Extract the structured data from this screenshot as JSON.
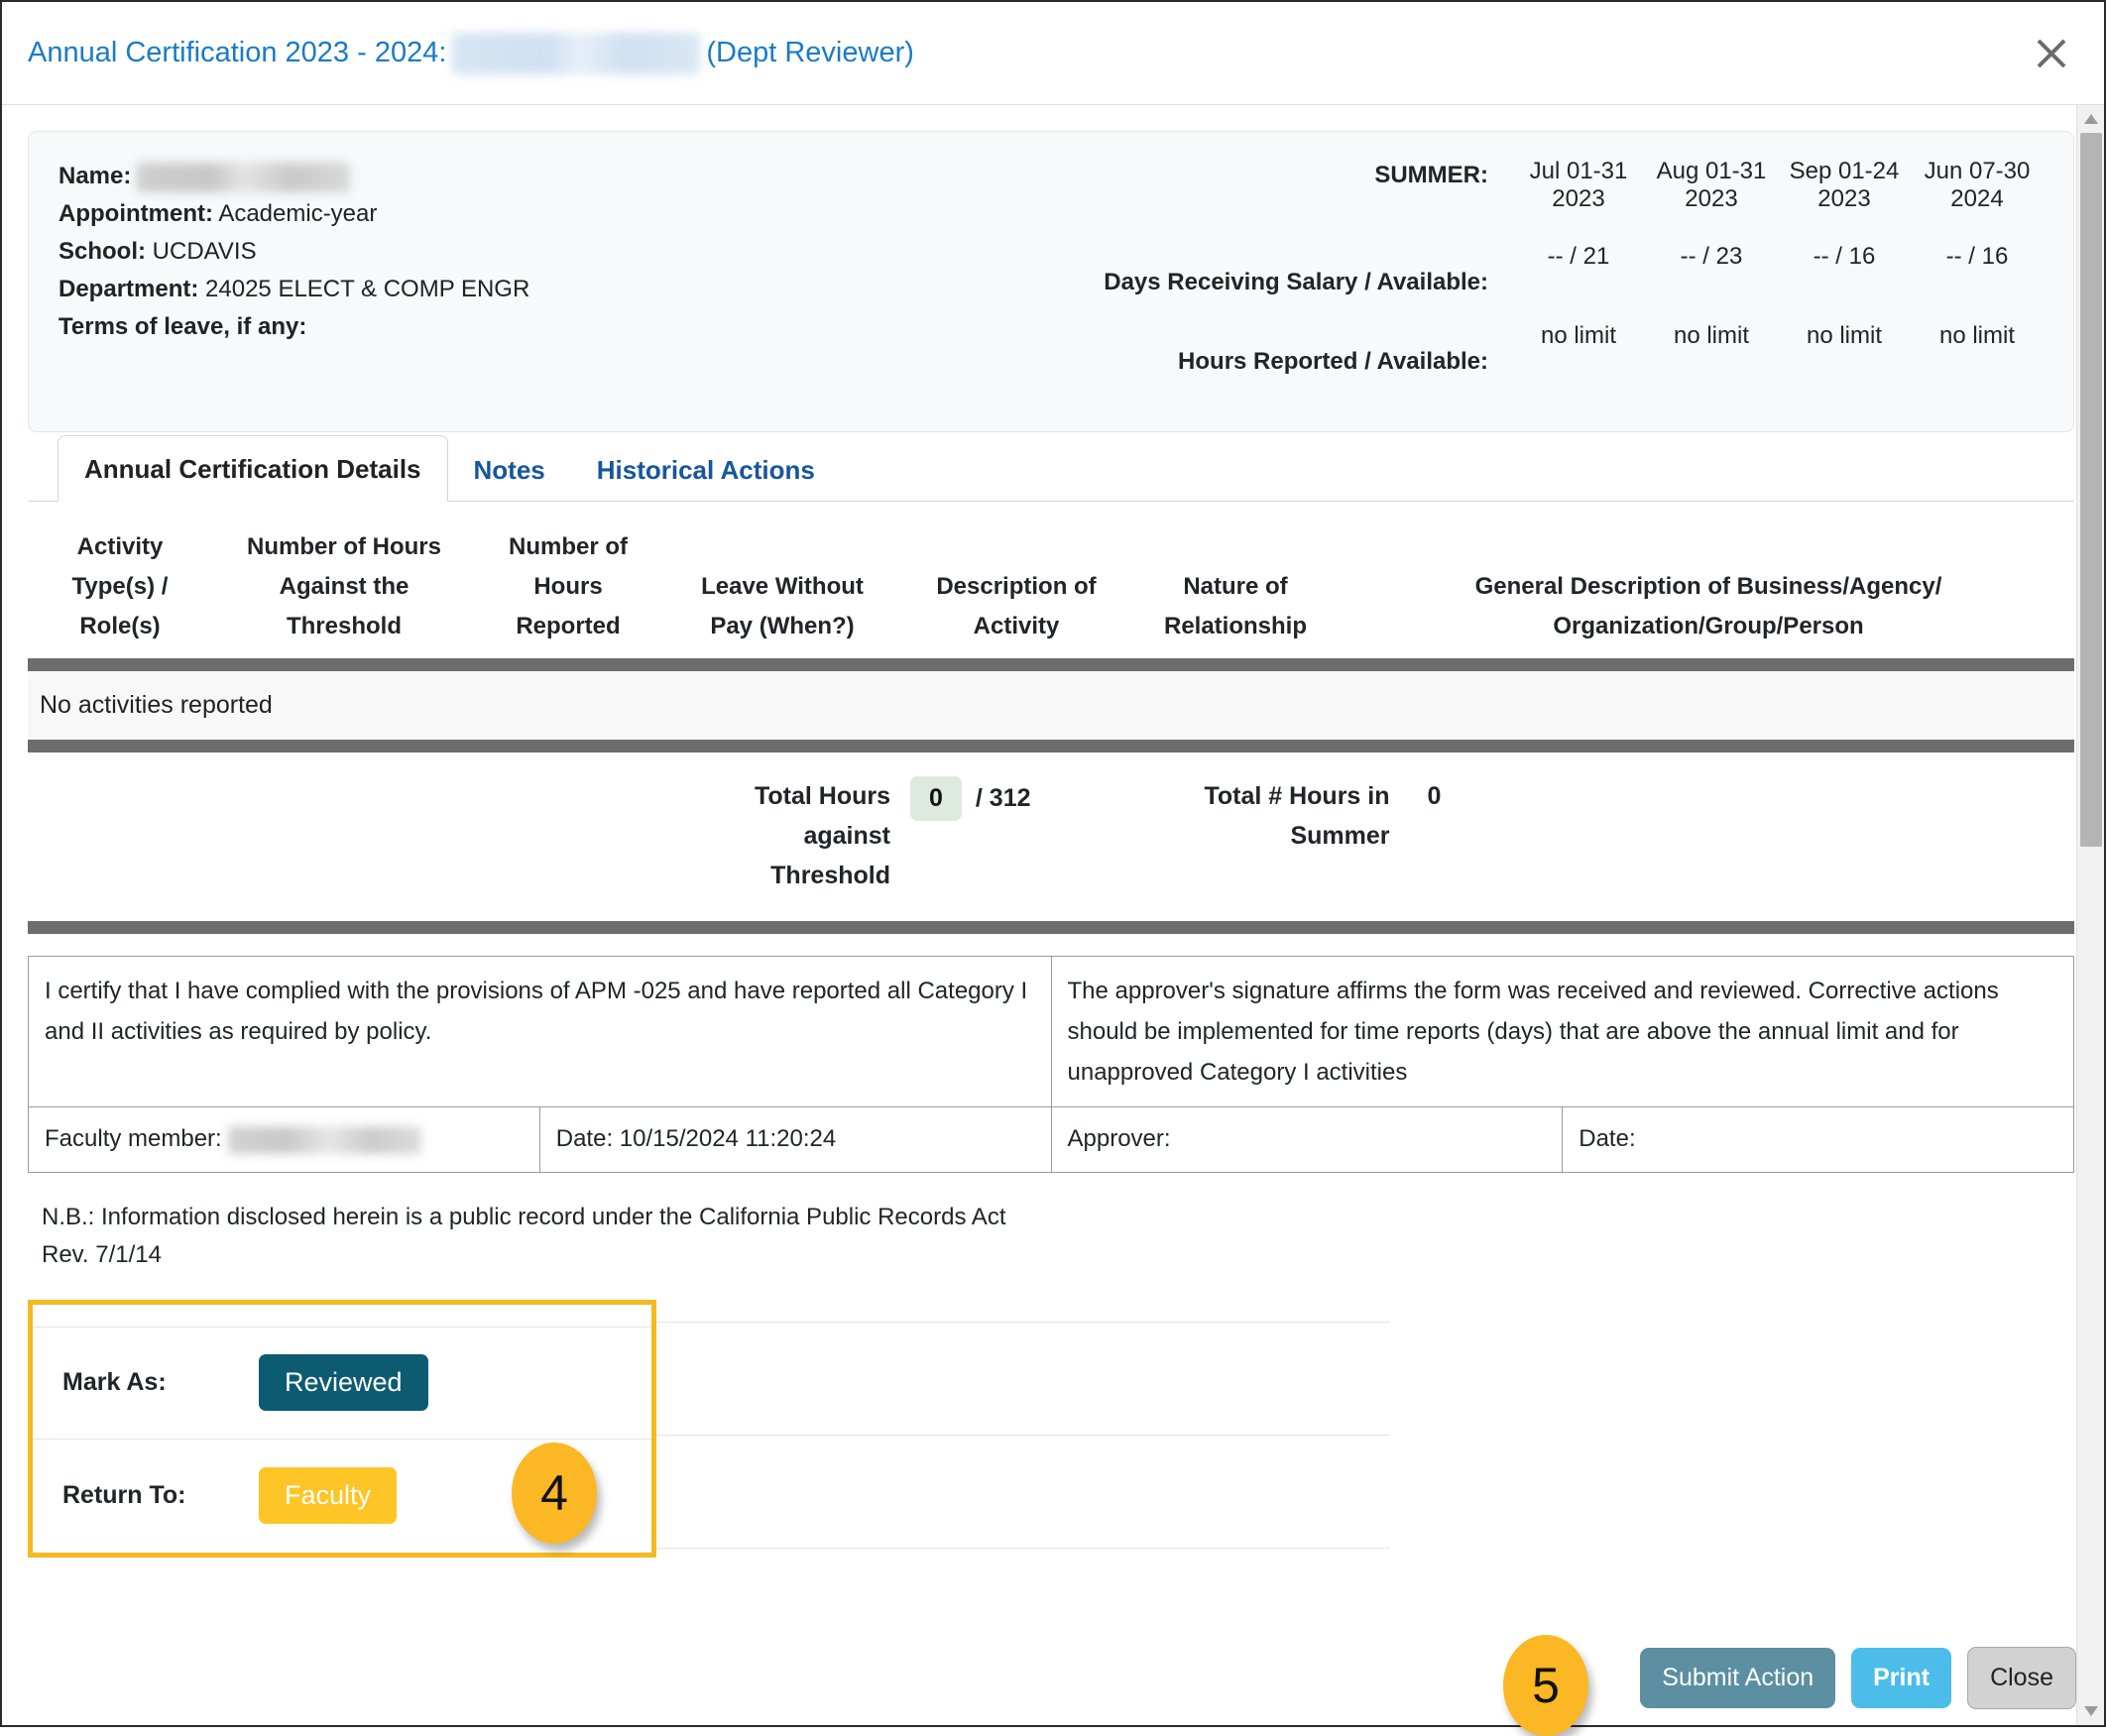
{
  "header": {
    "title_prefix": "Annual Certification 2023 - 2024:",
    "title_suffix": "(Dept Reviewer)",
    "close_icon": "close-icon"
  },
  "info": {
    "name_label": "Name:",
    "appointment_label": "Appointment:",
    "appointment_value": "Academic-year",
    "school_label": "School:",
    "school_value": "UCDAVIS",
    "department_label": "Department:",
    "department_value": "24025 ELECT & COMP ENGR",
    "terms_label": "Terms of leave, if any:"
  },
  "summer": {
    "summer_label": "SUMMER:",
    "days_label": "Days Receiving Salary / Available:",
    "hours_label": "Hours Reported / Available:",
    "columns": [
      {
        "month": "Jul 01-31",
        "year": "2023",
        "days": "-- / 21",
        "hours": "no limit"
      },
      {
        "month": "Aug 01-31",
        "year": "2023",
        "days": "-- / 23",
        "hours": "no limit"
      },
      {
        "month": "Sep 01-24",
        "year": "2023",
        "days": "-- / 16",
        "hours": "no limit"
      },
      {
        "month": "Jun 07-30",
        "year": "2024",
        "days": "-- / 16",
        "hours": "no limit"
      }
    ]
  },
  "tabs": [
    {
      "label": "Annual Certification Details",
      "active": true
    },
    {
      "label": "Notes",
      "active": false
    },
    {
      "label": "Historical Actions",
      "active": false
    }
  ],
  "activity_table": {
    "headers": [
      "Activity Type(s) / Role(s)",
      "Number of Hours Against the Threshold",
      "Number of Hours Reported",
      "Leave Without Pay (When?)",
      "Description of Activity",
      "Nature of Relationship",
      "General Description of Business/Agency/ Organization/Group/Person"
    ],
    "header_lines": [
      [
        "Activity",
        "Type(s) /",
        "Role(s)"
      ],
      [
        "Number of Hours",
        "Against the",
        "Threshold"
      ],
      [
        "Number of",
        "Hours",
        "Reported"
      ],
      [
        "Leave Without",
        "Pay (When?)"
      ],
      [
        "Description of",
        "Activity"
      ],
      [
        "Nature of",
        "Relationship"
      ],
      [
        "General Description of Business/Agency/",
        "Organization/Group/Person"
      ]
    ],
    "empty_message": "No activities reported"
  },
  "totals": {
    "threshold_label": "Total Hours against Threshold",
    "threshold_label_lines": [
      "Total Hours",
      "against",
      "Threshold"
    ],
    "threshold_value": "0",
    "threshold_max": "/ 312",
    "summer_label": "Total # Hours in Summer",
    "summer_label_lines": [
      "Total # Hours in",
      "Summer"
    ],
    "summer_value": "0"
  },
  "certification": {
    "faculty_statement": "I certify that I have complied with the provisions of APM -025 and have reported all Category I and II activities as required by policy.",
    "approver_statement": "The approver's signature affirms the form was received and reviewed. Corrective actions should be implemented for time reports (days) that are above the annual limit and for unapproved Category I activities",
    "faculty_member_label": "Faculty member:",
    "faculty_date_label": "Date: 10/15/2024 11:20:24",
    "approver_label": "Approver:",
    "approver_date_label": "Date:"
  },
  "note": {
    "line1": "N.B.: Information disclosed herein is a public record under the California Public Records Act",
    "line2": "Rev. 7/1/14"
  },
  "actions": {
    "mark_as_label": "Mark As:",
    "mark_as_button": "Reviewed",
    "return_to_label": "Return To:",
    "return_to_button": "Faculty"
  },
  "callouts": {
    "badge_4": "4",
    "badge_5": "5"
  },
  "footer": {
    "submit_label": "Submit Action",
    "print_label": "Print",
    "close_label": "Close"
  },
  "colors": {
    "title_blue": "#1a7bc4",
    "tab_blue": "#17569b",
    "reviewed_teal": "#0d5b70",
    "faculty_yellow": "#ffc425",
    "callout_yellow": "#fbb724",
    "highlight_border": "#f5b921",
    "submit_gray_blue": "#5b8fa1",
    "print_blue": "#4cbceb",
    "close_gray": "#d2d2d2",
    "pill_green": "#dfeade",
    "bar_dark": "#6d6d6d"
  }
}
